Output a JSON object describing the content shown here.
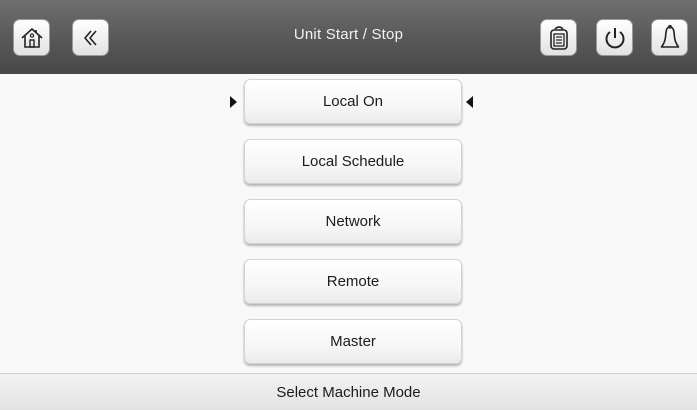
{
  "header": {
    "title": "Unit Start / Stop",
    "left_icons": [
      "home-icon",
      "back-icon"
    ],
    "right_icons": [
      "clipboard-icon",
      "power-icon",
      "alarm-bell-icon"
    ]
  },
  "modes": {
    "selected_index": 0,
    "items": [
      {
        "label": "Local On"
      },
      {
        "label": "Local Schedule"
      },
      {
        "label": "Network"
      },
      {
        "label": "Remote"
      },
      {
        "label": "Master"
      }
    ]
  },
  "footer": {
    "status_text": "Select Machine Mode"
  }
}
